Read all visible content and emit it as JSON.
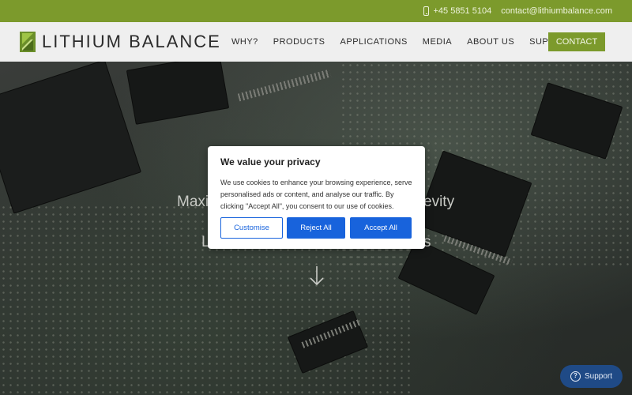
{
  "topbar": {
    "phone": "+45 5851 5104",
    "email": "contact@lithiumbalance.com"
  },
  "brand": {
    "name": "LITHIUM BALANCE",
    "accent": "#7c9a2c"
  },
  "nav": {
    "items": [
      {
        "label": "WHY?"
      },
      {
        "label": "PRODUCTS"
      },
      {
        "label": "APPLICATIONS"
      },
      {
        "label": "MEDIA"
      },
      {
        "label": "ABOUT US"
      },
      {
        "label": "SUPPORT"
      }
    ],
    "contact_label": "CONTACT"
  },
  "hero": {
    "line1_left": "Maxi",
    "line1_right": "evity",
    "line2_left": "L",
    "line2_right": "s"
  },
  "cookie": {
    "title": "We value your privacy",
    "body": "We use cookies to enhance your browsing experience, serve personalised ads or content, and analyse our traffic. By clicking \"Accept All\", you consent to our use of cookies.",
    "customise": "Customise",
    "reject": "Reject All",
    "accept": "Accept All",
    "accent": "#1863dc"
  },
  "support_widget": {
    "label": "Support",
    "icon": "question-icon",
    "symbol": "?"
  }
}
